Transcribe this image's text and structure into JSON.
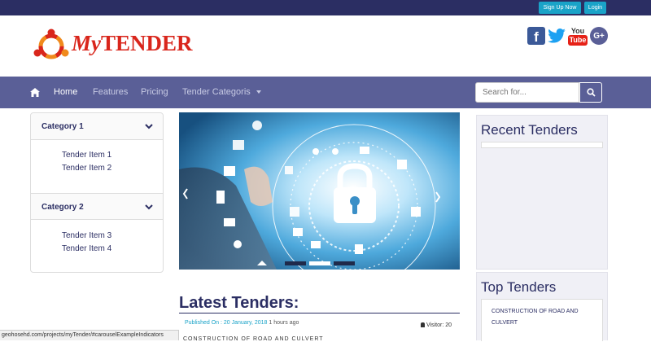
{
  "topbar": {
    "signup_label": "Sign Up Now",
    "login_label": "Login"
  },
  "logo": {
    "prefix": "My",
    "name": "TENDER"
  },
  "social": [
    {
      "icon": "facebook-icon",
      "color": "#3b5998"
    },
    {
      "icon": "twitter-icon",
      "color": "#1da1f2"
    },
    {
      "icon": "youtube-icon",
      "label_top": "You",
      "label_bottom": "Tube",
      "color": "#e62117"
    },
    {
      "icon": "google-plus-icon",
      "label": "G+",
      "color": "#5a5f97"
    }
  ],
  "nav": {
    "home": "Home",
    "features": "Features",
    "pricing": "Pricing",
    "categories": "Tender Categoris"
  },
  "search": {
    "placeholder": "Search for..."
  },
  "sidebar": {
    "categories": [
      {
        "label": "Category 1",
        "items": [
          "Tender Item 1",
          "Tender Item 2"
        ]
      },
      {
        "label": "Category 2",
        "items": [
          "Tender Item 3",
          "Tender Item 4"
        ]
      }
    ]
  },
  "main": {
    "latest_heading": "Latest Tenders:",
    "published_label": "Published On : 20 January, 2018",
    "published_ago": "1 hours ago",
    "visitor_label": "Visitor: 20"
  },
  "recent": {
    "title": "Recent Tenders"
  },
  "top": {
    "title": "Top Tenders",
    "item": "CONSTRUCTION OF ROAD AND CULVERT"
  },
  "status_url": "geohosehd.com/projects/myTender/#carouselExampleIndicators",
  "colors": {
    "navy": "#2b2e63",
    "nav": "#5a5f97",
    "accent": "#1aa3c8",
    "logo_red": "#d9261c"
  }
}
